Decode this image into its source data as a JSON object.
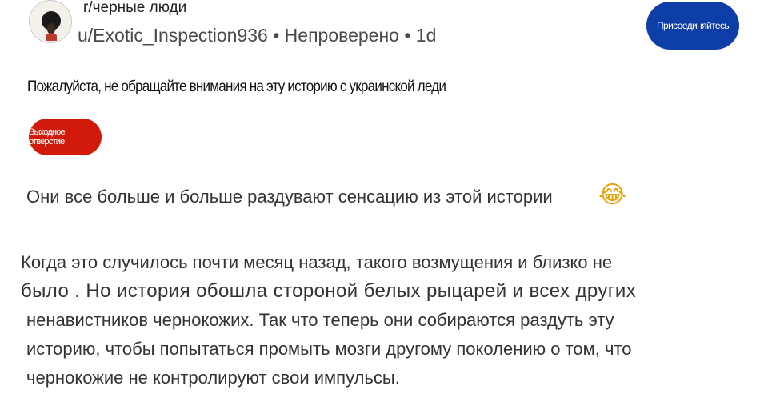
{
  "post": {
    "subreddit": "r/черные люди",
    "author": "u/Exotic_Inspection936",
    "status": "Непроверено",
    "age": "1d",
    "join_label": "Присоединяйтесь",
    "title": "Пожалуйста, не обращайте внимания на эту историю с украинской леди",
    "flair": "Выходное отверстие",
    "intro": "Они все больше и больше раздувают сенсацию из этой истории",
    "emoji": "😂",
    "paragraph": [
      "Когда это случилось почти месяц назад, такого возмущения и близко не",
      "было . Но история обошла стороной белых рыцарей и всех других",
      "ненавистников чернокожих. Так что теперь они собираются раздуть эту",
      "историю, чтобы попытаться промыть мозги другому поколению о том, что",
      "чернокожие не контролируют свои импульсы."
    ]
  }
}
